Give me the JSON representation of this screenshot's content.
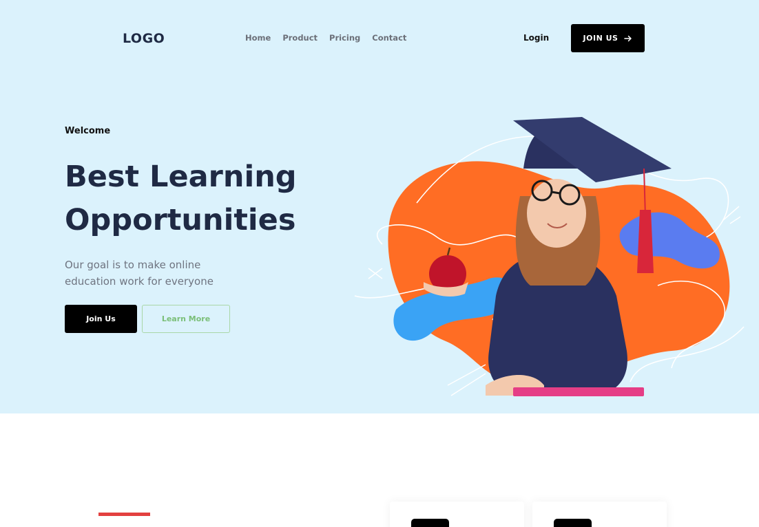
{
  "header": {
    "logo": "LOGO",
    "nav": [
      "Home",
      "Product",
      "Pricing",
      "Contact"
    ],
    "login": "Login",
    "join_button": "JOIN US"
  },
  "hero": {
    "eyebrow": "Welcome",
    "headline_line1": "Best Learning",
    "headline_line2": "Opportunities",
    "subtext_line1": "Our goal is to make online",
    "subtext_line2": "education work for everyone",
    "primary_button": "Join Us",
    "secondary_button": "Learn More",
    "illustration": "graduate-girl-illustration"
  },
  "colors": {
    "hero_background": "#dbf2fc",
    "primary": "#000000",
    "accent_green": "#7bbf78",
    "accent_red": "#e3403f",
    "blob_orange": "#ff6d24",
    "blob_blue": "#3aa3f5"
  },
  "icons": {
    "join_arrow": "arrow-right-icon"
  }
}
